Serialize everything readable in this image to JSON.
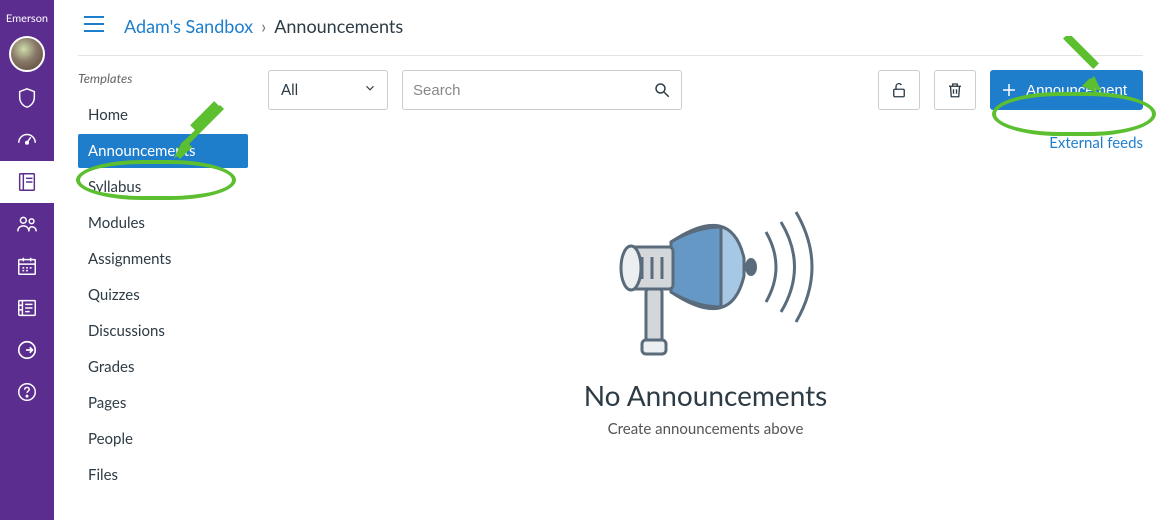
{
  "brand": "Emerson",
  "breadcrumbs": {
    "link": "Adam's Sandbox",
    "separator": "›",
    "current": "Announcements"
  },
  "course_nav": {
    "templates_label": "Templates",
    "items": [
      {
        "label": "Home"
      },
      {
        "label": "Announcements",
        "active": true
      },
      {
        "label": "Syllabus"
      },
      {
        "label": "Modules"
      },
      {
        "label": "Assignments"
      },
      {
        "label": "Quizzes"
      },
      {
        "label": "Discussions"
      },
      {
        "label": "Grades"
      },
      {
        "label": "Pages"
      },
      {
        "label": "People"
      },
      {
        "label": "Files"
      }
    ]
  },
  "toolbar": {
    "filter_selected": "All",
    "search_placeholder": "Search",
    "primary_label": "Announcement"
  },
  "external_feeds_label": "External feeds",
  "empty_state": {
    "title": "No Announcements",
    "subtitle": "Create announcements above"
  },
  "global_nav_icons": [
    "avatar",
    "shield-icon",
    "gauge-icon",
    "book-icon",
    "people-icon",
    "calendar-icon",
    "inbox-icon",
    "logout-icon",
    "help-icon"
  ]
}
